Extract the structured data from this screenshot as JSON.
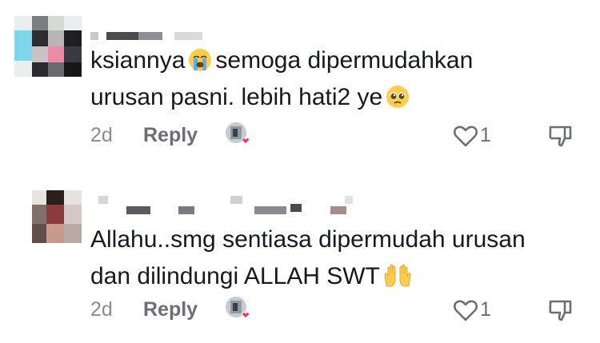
{
  "comments": [
    {
      "text_line1": "ksiannya",
      "text_line1_rest": "semoga dipermudahkan",
      "text_line2": "urusan pasni. lebih hati2 ye",
      "line1_emoji": "loudly-crying-face-emoji",
      "line2_emoji": "pleading-face-emoji",
      "time": "2d",
      "reply_label": "Reply",
      "likes": "1"
    },
    {
      "text_line1": "Allahu..smg sentiasa dipermudah urusan",
      "text_line2": "dan dilindungi ALLAH SWT",
      "line2_emoji": "raising-hands-emoji",
      "time": "2d",
      "reply_label": "Reply",
      "likes": "1"
    }
  ],
  "icons": {
    "like": "heart-outline-icon",
    "dislike": "thumbs-down-outline-icon",
    "creator_liked": "creator-heart-badge-icon"
  },
  "colors": {
    "text": "#161823",
    "meta": "#8a8b91",
    "reply": "#6d6e75",
    "heart_badge": "#fe2c55",
    "emoji_yellow": "#ffcc4d"
  }
}
